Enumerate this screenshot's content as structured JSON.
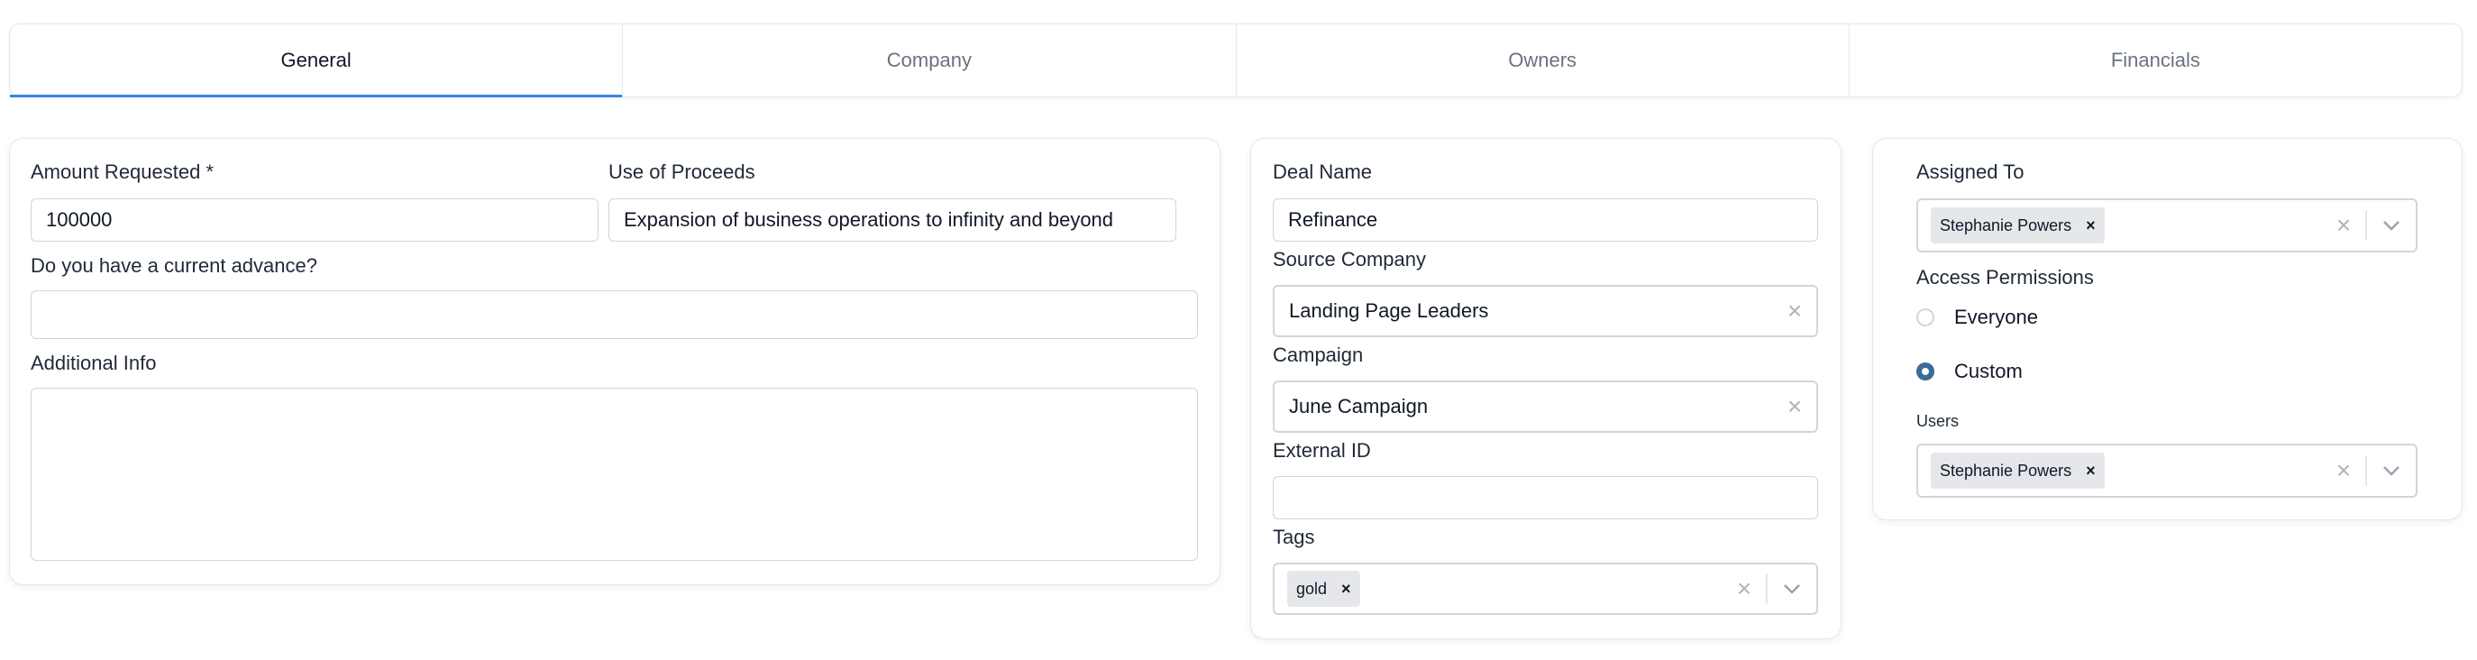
{
  "tabs": [
    {
      "label": "General",
      "active": true
    },
    {
      "label": "Company",
      "active": false
    },
    {
      "label": "Owners",
      "active": false
    },
    {
      "label": "Financials",
      "active": false
    }
  ],
  "left": {
    "amount_label": "Amount Requested *",
    "amount_value": "100000",
    "proceeds_label": "Use of Proceeds",
    "proceeds_value": "Expansion of business operations to infinity and beyond",
    "advance_label": "Do you have a current advance?",
    "advance_value": "",
    "info_label": "Additional Info",
    "info_value": ""
  },
  "middle": {
    "deal_name_label": "Deal Name",
    "deal_name_value": "Refinance",
    "source_label": "Source Company",
    "source_value": "Landing Page Leaders",
    "campaign_label": "Campaign",
    "campaign_value": "June Campaign",
    "external_label": "External ID",
    "external_value": "",
    "tags_label": "Tags",
    "tags": [
      "gold"
    ]
  },
  "right": {
    "assigned_label": "Assigned To",
    "assigned": [
      "Stephanie Powers"
    ],
    "access_label": "Access Permissions",
    "options": [
      "Everyone",
      "Custom"
    ],
    "selected_option": "Custom",
    "users_label": "Users",
    "users": [
      "Stephanie Powers"
    ]
  },
  "icons": {
    "clear": "clear-x-icon",
    "remove": "chip-remove-icon",
    "dropdown": "chevron-down-icon"
  },
  "colors": {
    "accent": "#3b82f6",
    "radio_selected": "#3b6b96"
  }
}
